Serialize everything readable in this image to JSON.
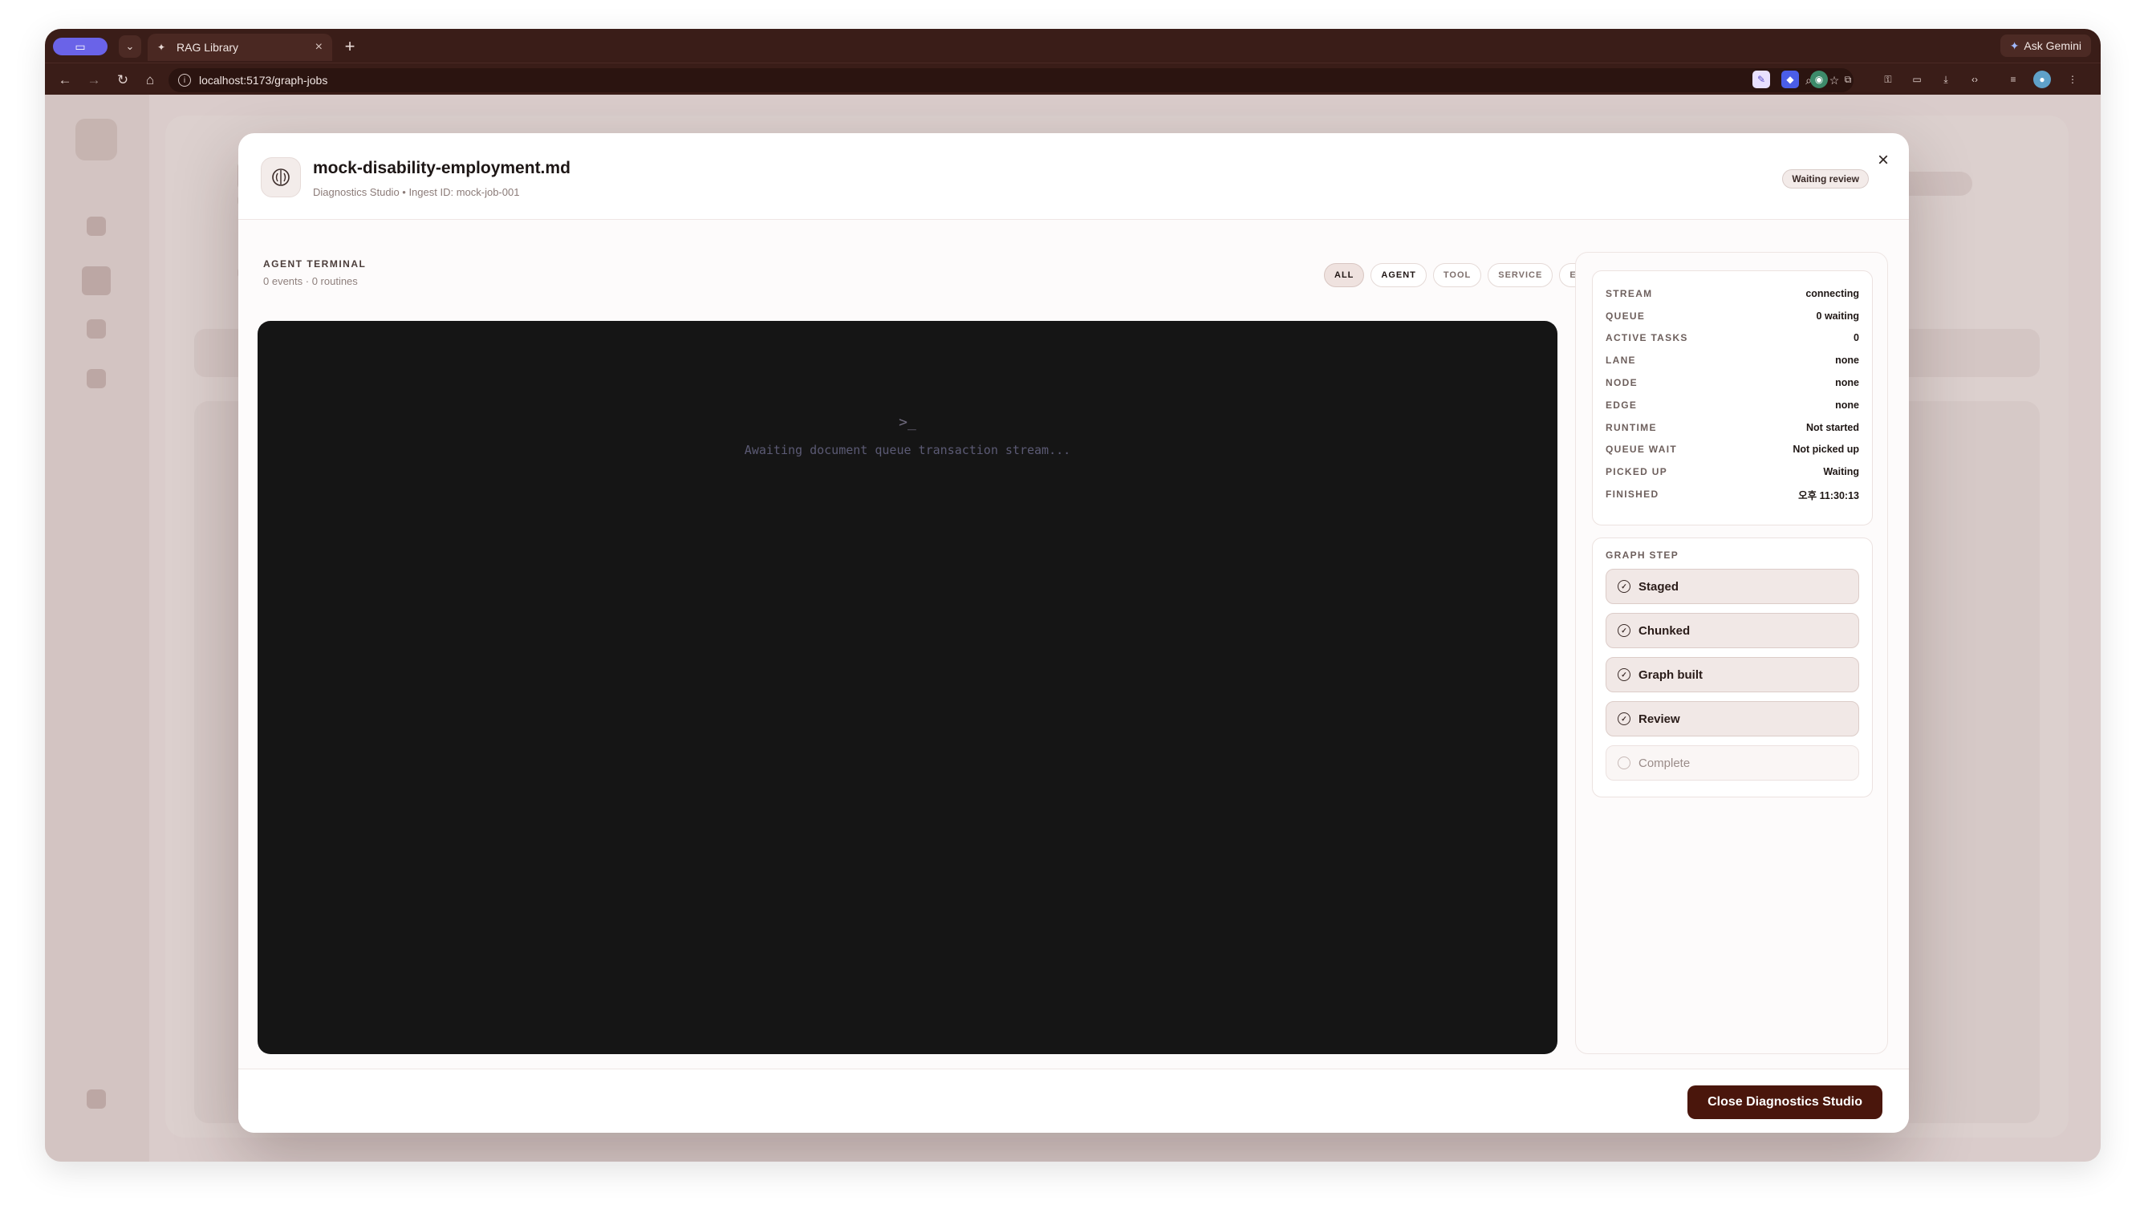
{
  "browser": {
    "tab_title": "RAG Library",
    "url": "localhost:5173/graph-jobs",
    "ask_gemini": "Ask Gemini"
  },
  "modal": {
    "title": "mock-disability-employment.md",
    "subtitle": "Diagnostics Studio • Ingest ID: mock-job-001",
    "status": "Waiting review",
    "close_symbol": "×"
  },
  "terminal": {
    "title": "AGENT TERMINAL",
    "summary": "0 events · 0 routines",
    "filters": [
      "ALL",
      "AGENT",
      "TOOL",
      "SERVICE",
      "ERROR"
    ],
    "active_filter": "ALL",
    "prompt": ">_",
    "message": "Awaiting document queue transaction stream..."
  },
  "stats": [
    {
      "label": "STREAM",
      "value": "connecting"
    },
    {
      "label": "QUEUE",
      "value": "0 waiting"
    },
    {
      "label": "ACTIVE TASKS",
      "value": "0"
    },
    {
      "label": "LANE",
      "value": "none"
    },
    {
      "label": "NODE",
      "value": "none"
    },
    {
      "label": "EDGE",
      "value": "none"
    },
    {
      "label": "RUNTIME",
      "value": "Not started"
    },
    {
      "label": "QUEUE WAIT",
      "value": "Not picked up"
    },
    {
      "label": "PICKED UP",
      "value": "Waiting"
    },
    {
      "label": "FINISHED",
      "value": "오후 11:30:13"
    }
  ],
  "graph_steps": {
    "title": "GRAPH STEP",
    "steps": [
      {
        "label": "Staged",
        "done": true
      },
      {
        "label": "Chunked",
        "done": true
      },
      {
        "label": "Graph built",
        "done": true
      },
      {
        "label": "Review",
        "done": true
      },
      {
        "label": "Complete",
        "done": false
      }
    ]
  },
  "footer": {
    "close_label": "Close Diagnostics Studio"
  },
  "colors": {
    "accent": "#4a160c",
    "terminal_bg": "#151515",
    "chrome": "#3a1d18"
  }
}
